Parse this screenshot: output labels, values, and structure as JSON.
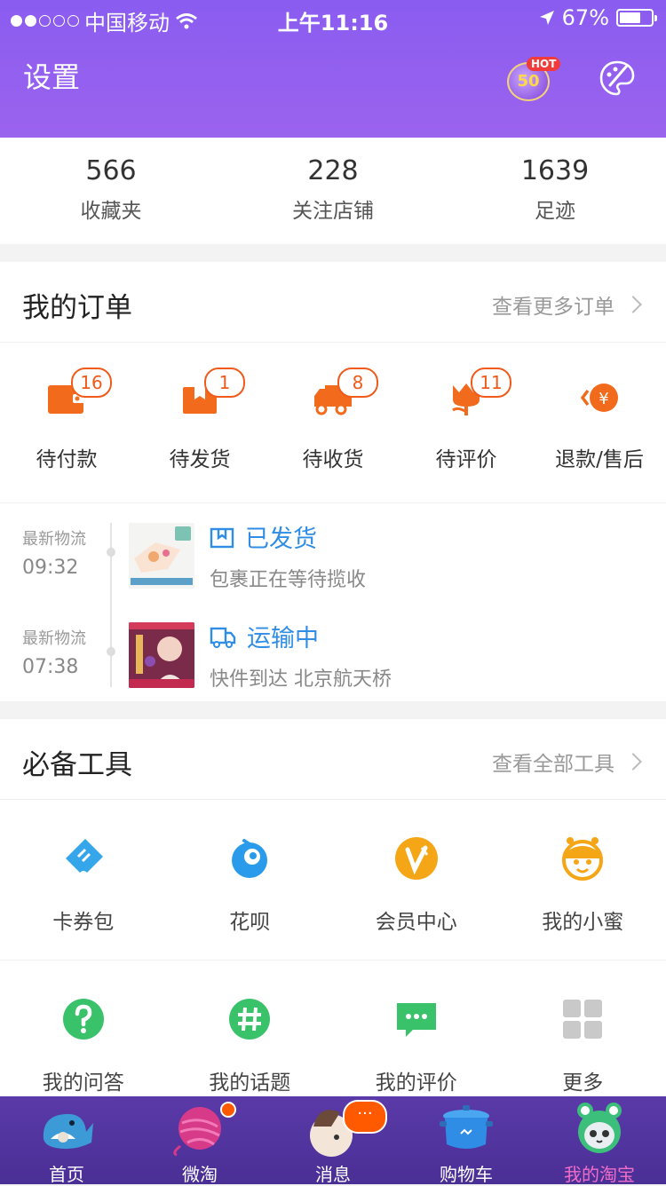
{
  "status_bar": {
    "carrier": "中国移动",
    "time": "上午11:16",
    "battery": "67%",
    "battery_level": 0.67
  },
  "header": {
    "title": "设置",
    "badge_tag": "HOT",
    "badge_number": "50"
  },
  "stats": [
    {
      "value": "566",
      "label": "收藏夹"
    },
    {
      "value": "228",
      "label": "关注店铺"
    },
    {
      "value": "1639",
      "label": "足迹"
    }
  ],
  "orders": {
    "title": "我的订单",
    "more": "查看更多订单",
    "items": [
      {
        "label": "待付款",
        "badge": "16",
        "icon": "wallet-icon"
      },
      {
        "label": "待发货",
        "badge": "1",
        "icon": "package-icon"
      },
      {
        "label": "待收货",
        "badge": "8",
        "icon": "truck-icon"
      },
      {
        "label": "待评价",
        "badge": "11",
        "icon": "tulip-icon"
      },
      {
        "label": "退款/售后",
        "badge": "",
        "icon": "refund-icon"
      }
    ]
  },
  "logistics": [
    {
      "label": "最新物流",
      "time": "09:32",
      "status": "已发货",
      "desc": "包裹正在等待揽收",
      "icon": "package-outline-icon"
    },
    {
      "label": "最新物流",
      "time": "07:38",
      "status": "运输中",
      "desc": "快件到达 北京航天桥",
      "icon": "truck-outline-icon"
    }
  ],
  "tools": {
    "title": "必备工具",
    "more": "查看全部工具",
    "items": [
      {
        "label": "卡券包",
        "icon": "ticket-icon"
      },
      {
        "label": "花呗",
        "icon": "huabei-icon"
      },
      {
        "label": "会员中心",
        "icon": "vip-icon"
      },
      {
        "label": "我的小蜜",
        "icon": "assistant-icon"
      },
      {
        "label": "我的问答",
        "icon": "question-icon"
      },
      {
        "label": "我的话题",
        "icon": "hashtag-icon"
      },
      {
        "label": "我的评价",
        "icon": "comment-icon"
      },
      {
        "label": "更多",
        "icon": "grid-icon"
      }
    ]
  },
  "tabbar": [
    {
      "label": "首页",
      "icon": "whale-icon"
    },
    {
      "label": "微淘",
      "icon": "yarn-icon"
    },
    {
      "label": "消息",
      "icon": "cat-icon",
      "bubble": "···"
    },
    {
      "label": "购物车",
      "icon": "pot-icon"
    },
    {
      "label": "我的淘宝",
      "icon": "frog-cat-icon",
      "active": true
    }
  ],
  "colors": {
    "header_purple": "#8a5cf0",
    "order_orange": "#f05a1a",
    "link_blue": "#2f8de6",
    "tab_active": "#f06ec8"
  }
}
